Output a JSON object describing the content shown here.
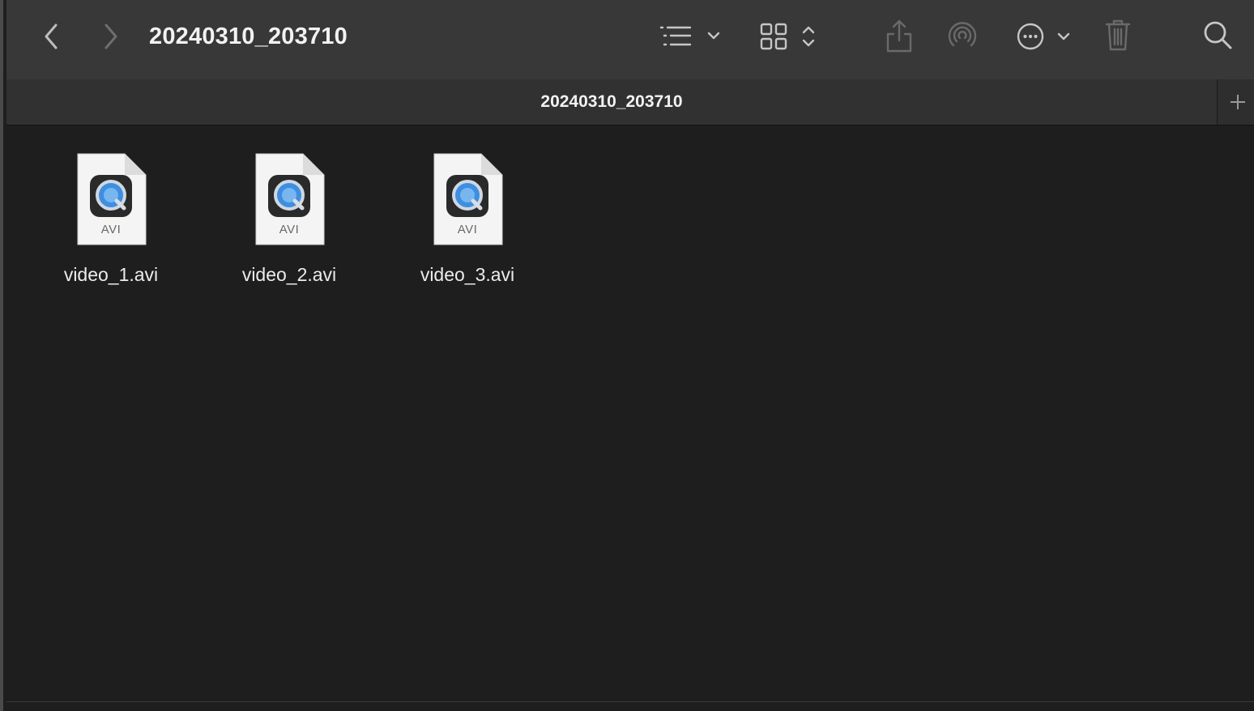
{
  "window": {
    "title": "20240310_203710",
    "tab_title": "20240310_203710"
  },
  "toolbar": {
    "icons": [
      "chevron-left-icon",
      "chevron-right-icon",
      "list-view-icon",
      "chevron-down-icon",
      "grid-view-icon",
      "chevron-updown-icon",
      "share-icon",
      "airdrop-icon",
      "more-icon",
      "chevron-down-icon",
      "trash-icon",
      "search-icon"
    ]
  },
  "files": [
    {
      "name": "video_1.avi",
      "type_label": "AVI"
    },
    {
      "name": "video_2.avi",
      "type_label": "AVI"
    },
    {
      "name": "video_3.avi",
      "type_label": "AVI"
    }
  ],
  "colors": {
    "toolbar_bg": "#383838",
    "content_bg": "#1e1e1e",
    "quicktime_blue": "#3e8fe0"
  }
}
